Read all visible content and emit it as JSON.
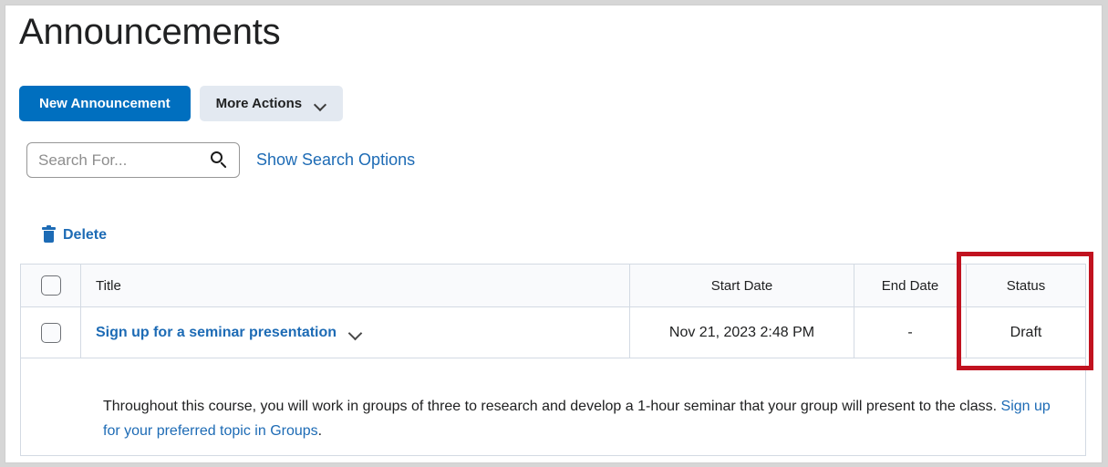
{
  "page": {
    "title": "Announcements"
  },
  "toolbar": {
    "new_announcement_label": "New Announcement",
    "more_actions_label": "More Actions",
    "more_actions_icon": "chevron-down-icon"
  },
  "search": {
    "placeholder": "Search For...",
    "value": "",
    "icon": "search-icon",
    "show_search_options_label": "Show Search Options"
  },
  "bulk_actions": {
    "delete_label": "Delete",
    "delete_icon": "trash-icon"
  },
  "table": {
    "columns": [
      {
        "key": "check",
        "label": ""
      },
      {
        "key": "title",
        "label": "Title"
      },
      {
        "key": "start",
        "label": "Start Date"
      },
      {
        "key": "end",
        "label": "End Date"
      },
      {
        "key": "status",
        "label": "Status"
      }
    ],
    "rows": [
      {
        "title": "Sign up for a seminar presentation",
        "expand_icon": "chevron-down-icon",
        "start_date": "Nov 21, 2023 2:48 PM",
        "end_date": "-",
        "status": "Draft",
        "body_text_before_link": "Throughout this course, you will work in groups of three to research and develop a 1-hour seminar that your group will present to the class. ",
        "body_link_text": "Sign up for your preferred topic in Groups",
        "body_text_after_link": "."
      }
    ]
  },
  "annotation": {
    "highlight_target": "status-column",
    "highlight_color": "#c1121f"
  },
  "colors": {
    "primary_button": "#006fbf",
    "secondary_button": "#e3e9f1",
    "link": "#1d6bb5",
    "header_row_background": "#f9fafc",
    "table_border": "#d3dae3",
    "text": "#202122"
  }
}
